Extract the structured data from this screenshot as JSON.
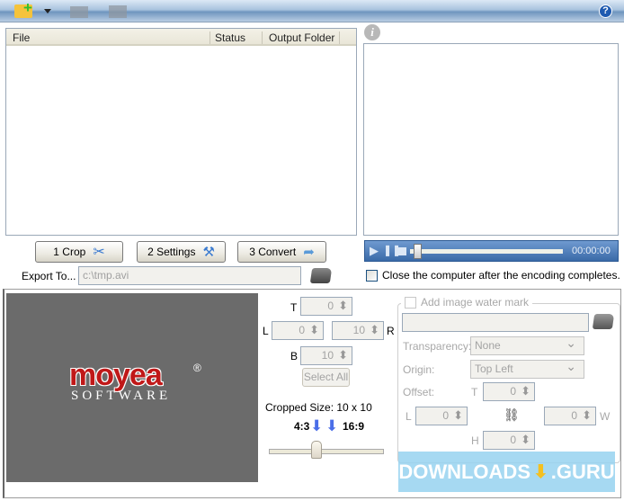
{
  "toolbar": {
    "icons": [
      "add-folder-icon",
      "dropdown-arrow-icon",
      "folder-icon",
      "remove-folder-icon",
      "help-icon"
    ]
  },
  "file_list": {
    "columns": [
      "File",
      "Status",
      "Output Folder"
    ]
  },
  "actions": {
    "crop": "1 Crop",
    "settings": "2 Settings",
    "convert": "3 Convert"
  },
  "export": {
    "label": "Export To...",
    "value": "c:\\tmp.avi"
  },
  "player": {
    "time": "00:00:00",
    "progress": 0
  },
  "close_after": {
    "label": "Close the computer after the encoding completes.",
    "checked": false
  },
  "preview": {
    "logo": "moyea",
    "logo_sub": "SOFTWARE",
    "logo_mark": "®"
  },
  "crop": {
    "t_label": "T",
    "t": "0",
    "l_label": "L",
    "l": "0",
    "r_label": "R",
    "r": "10",
    "b_label": "B",
    "b": "10",
    "select_all": "Select All",
    "cropped_size": "Cropped Size: 10 x 10",
    "ratio_a": "4:3",
    "ratio_b": "16:9"
  },
  "watermark": {
    "label": "Add image water mark",
    "checked": false,
    "path": "",
    "transparency_label": "Transparency:",
    "transparency": "None",
    "origin_label": "Origin:",
    "origin": "Top Left",
    "offset_label": "Offset:",
    "t_label": "T",
    "t": "0",
    "l_label": "L",
    "l": "0",
    "w_label": "W",
    "w": "0",
    "h_label": "H",
    "h": "0"
  },
  "banner": {
    "text": "DOWNLOADS",
    ".guru": ".GURU"
  }
}
